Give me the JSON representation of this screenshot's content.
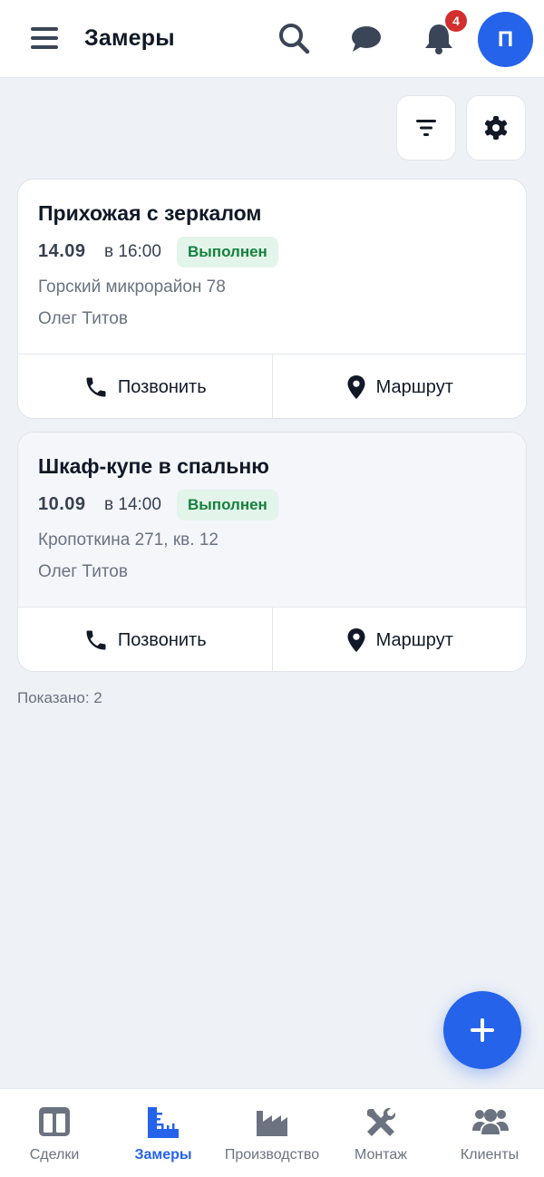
{
  "header": {
    "title": "Замеры",
    "notifications_count": "4",
    "avatar_initial": "П"
  },
  "cards": [
    {
      "title": "Прихожая с зеркалом",
      "date": "14.09",
      "time": "в 16:00",
      "status": "Выполнен",
      "address": "Горский микрорайон 78",
      "person": "Олег Титов",
      "call_label": "Позвонить",
      "route_label": "Маршрут"
    },
    {
      "title": "Шкаф-купе в спальню",
      "date": "10.09",
      "time": "в 14:00",
      "status": "Выполнен",
      "address": "Кропоткина 271, кв. 12",
      "person": "Олег Титов",
      "call_label": "Позвонить",
      "route_label": "Маршрут"
    }
  ],
  "shown_count": "Показано: 2",
  "bottom_nav": {
    "items": [
      {
        "label": "Сделки",
        "icon": "columns-icon"
      },
      {
        "label": "Замеры",
        "icon": "ruler-icon",
        "active": true
      },
      {
        "label": "Производство",
        "icon": "factory-icon"
      },
      {
        "label": "Монтаж",
        "icon": "tools-icon"
      },
      {
        "label": "Клиенты",
        "icon": "users-icon"
      }
    ]
  },
  "colors": {
    "accent": "#2563eb",
    "status_bg": "#e3f4ea",
    "status_text": "#15803d",
    "badge": "#d32f2f",
    "background": "#eef1f6"
  }
}
